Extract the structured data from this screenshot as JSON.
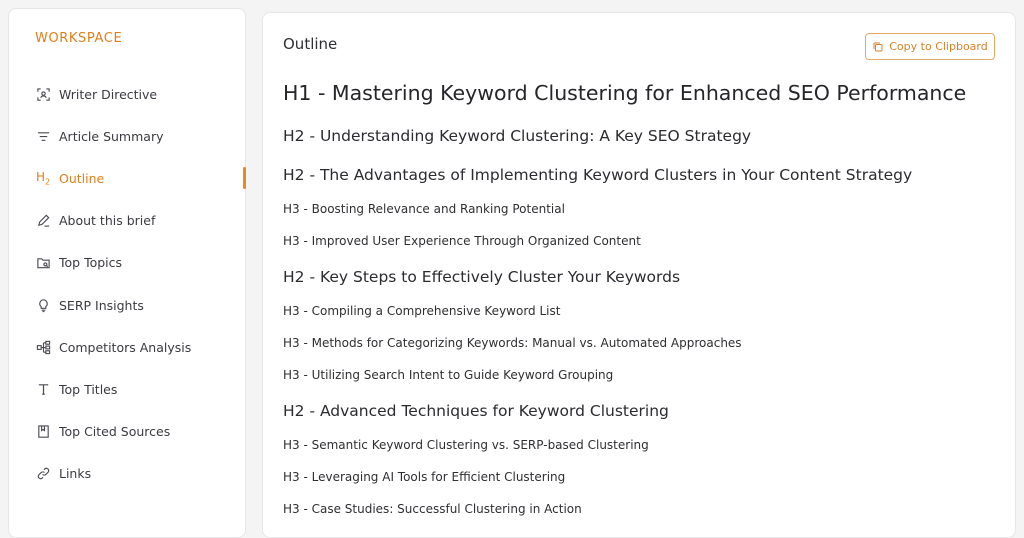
{
  "sidebar": {
    "title": "WORKSPACE",
    "items": [
      {
        "label": "Writer Directive",
        "icon": "scan-focus-icon"
      },
      {
        "label": "Article Summary",
        "icon": "lines-filter-icon"
      },
      {
        "label": "Outline",
        "icon": "heading-h2-icon",
        "active": true
      },
      {
        "label": "About this brief",
        "icon": "pencil-icon"
      },
      {
        "label": "Top Topics",
        "icon": "folder-search-icon"
      },
      {
        "label": "SERP Insights",
        "icon": "lightbulb-icon"
      },
      {
        "label": "Competitors Analysis",
        "icon": "hierarchy-icon"
      },
      {
        "label": "Top Titles",
        "icon": "text-t-icon"
      },
      {
        "label": "Top Cited Sources",
        "icon": "bookmark-book-icon"
      },
      {
        "label": "Links",
        "icon": "link-icon"
      }
    ]
  },
  "main": {
    "title": "Outline",
    "copy_button": "Copy to Clipboard",
    "outline": [
      {
        "level": "h1",
        "text": "H1 - Mastering Keyword Clustering for Enhanced SEO Performance"
      },
      {
        "level": "h2",
        "text": "H2 - Understanding Keyword Clustering: A Key SEO Strategy"
      },
      {
        "level": "h2",
        "text": "H2 - The Advantages of Implementing Keyword Clusters in Your Content Strategy"
      },
      {
        "level": "h3",
        "text": "H3 - Boosting Relevance and Ranking Potential"
      },
      {
        "level": "h3",
        "text": "H3 - Improved User Experience Through Organized Content"
      },
      {
        "level": "h2",
        "text": "H2 - Key Steps to Effectively Cluster Your Keywords"
      },
      {
        "level": "h3",
        "text": "H3 - Compiling a Comprehensive Keyword List"
      },
      {
        "level": "h3",
        "text": "H3 - Methods for Categorizing Keywords: Manual vs. Automated Approaches"
      },
      {
        "level": "h3",
        "text": "H3 - Utilizing Search Intent to Guide Keyword Grouping"
      },
      {
        "level": "h2",
        "text": "H2 - Advanced Techniques for Keyword Clustering"
      },
      {
        "level": "h3",
        "text": "H3 - Semantic Keyword Clustering vs. SERP-based Clustering"
      },
      {
        "level": "h3",
        "text": "H3 - Leveraging AI Tools for Efficient Clustering"
      },
      {
        "level": "h3",
        "text": "H3 - Case Studies: Successful Clustering in Action"
      }
    ]
  },
  "colors": {
    "accent": "#e07f1a",
    "text": "#2f2f33",
    "background": "#f4f4f5"
  }
}
